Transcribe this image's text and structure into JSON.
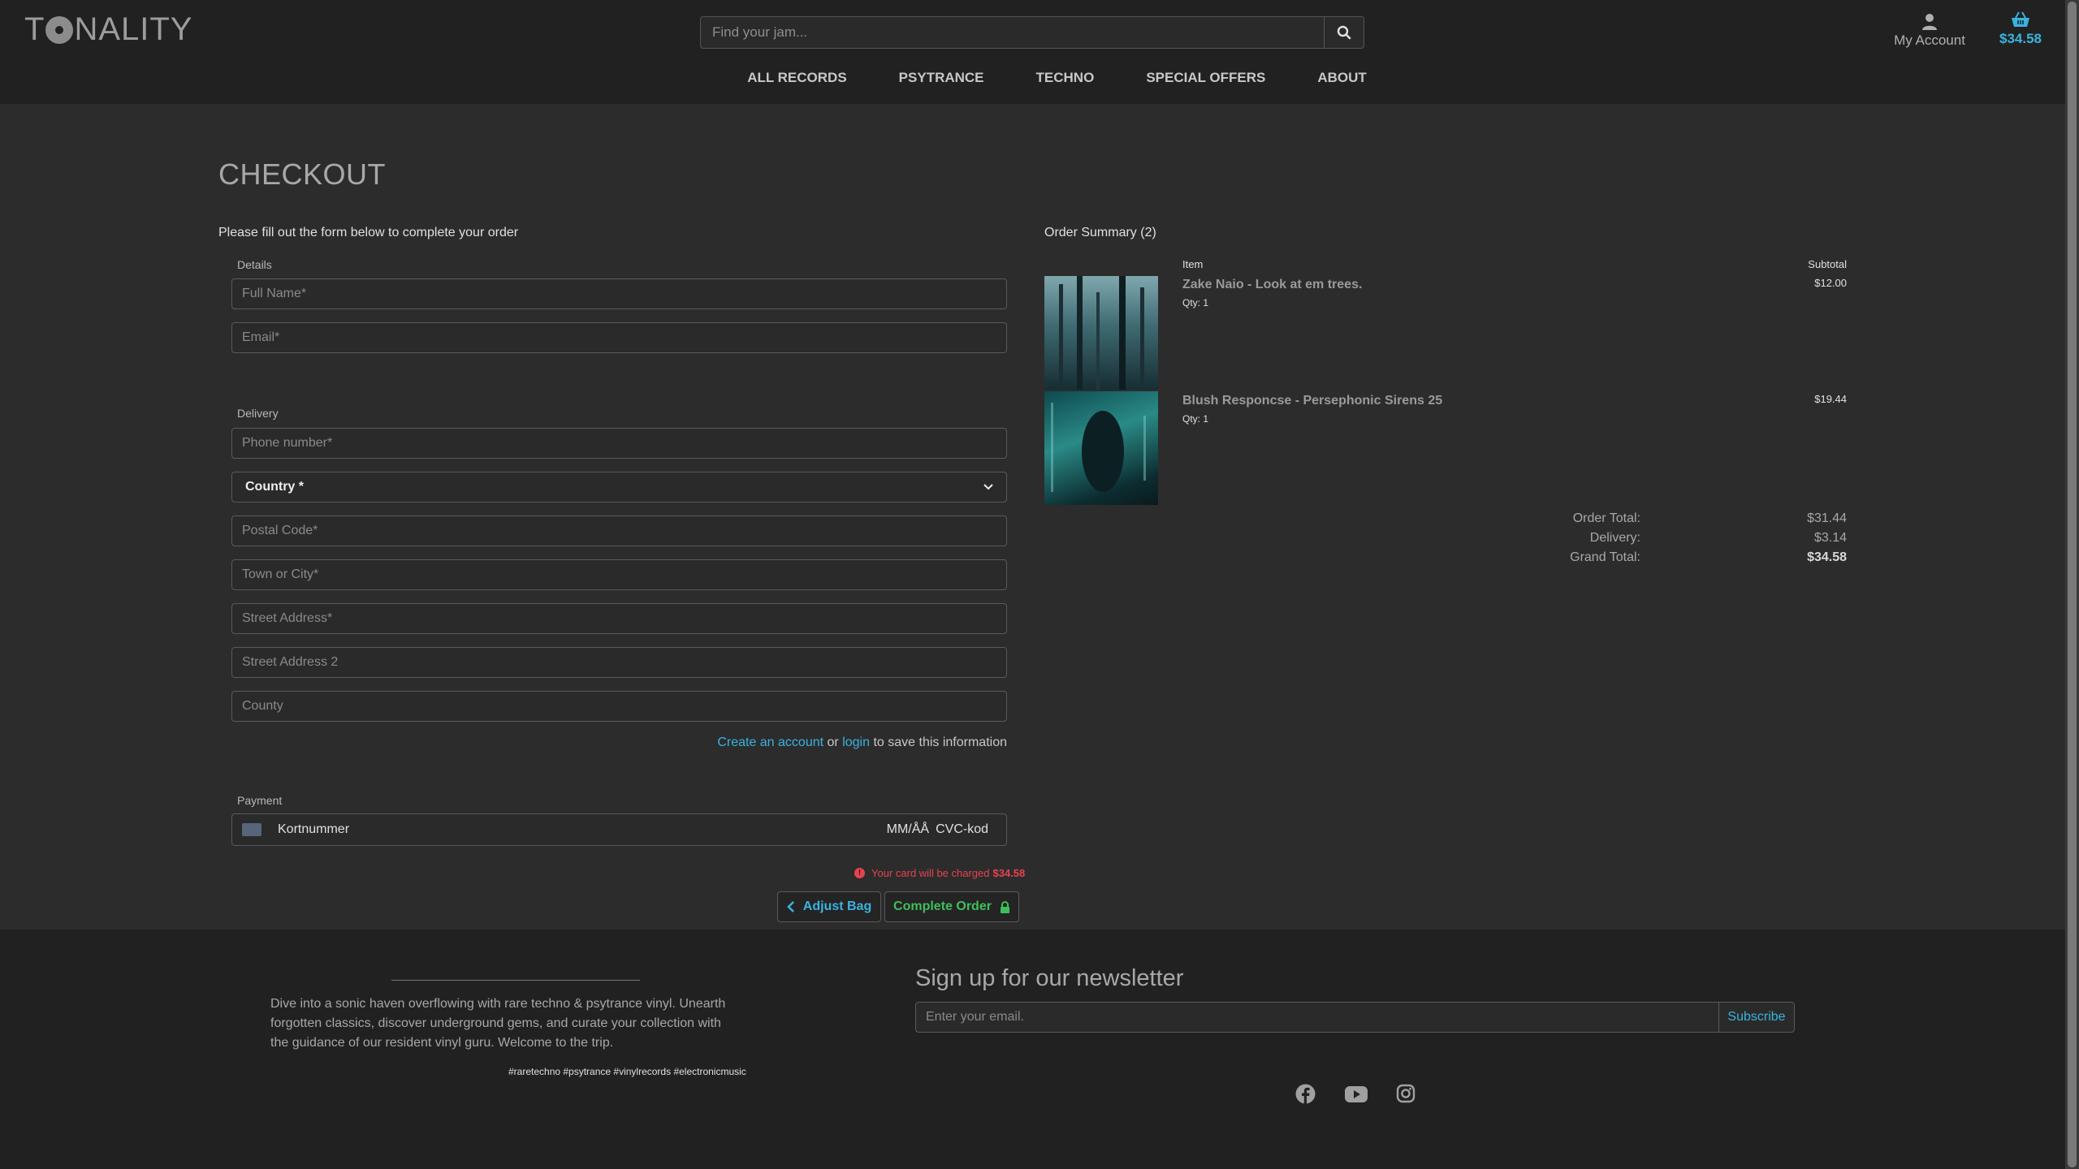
{
  "header": {
    "logo_text_pre": "T",
    "logo_text_post": "NALITY",
    "search_placeholder": "Find your jam...",
    "account_label": "My Account",
    "bag_total": "$34.58",
    "nav": [
      "ALL RECORDS",
      "PSYTRANCE",
      "TECHNO",
      "SPECIAL OFFERS",
      "ABOUT"
    ]
  },
  "checkout": {
    "title": "CHECKOUT",
    "intro": "Please fill out the form below to complete your order",
    "details_label": "Details",
    "full_name_placeholder": "Full Name*",
    "email_placeholder": "Email*",
    "delivery_label": "Delivery",
    "phone_placeholder": "Phone number*",
    "country_value": "Country *",
    "postal_placeholder": "Postal Code*",
    "town_placeholder": "Town or City*",
    "street1_placeholder": "Street Address*",
    "street2_placeholder": "Street Address 2",
    "county_placeholder": "County",
    "create_account": "Create an account",
    "or_text": "or",
    "login": "login",
    "save_text": "to save this information",
    "payment_label": "Payment",
    "card_number": "Kortnummer",
    "card_expiry": "MM/ÅÅ",
    "card_cvc": "CVC-kod",
    "charge_text": "Your card will be charged",
    "charge_amount": "$34.58",
    "adjust_bag": "Adjust Bag",
    "complete_order": "Complete Order"
  },
  "summary": {
    "title": "Order Summary (2)",
    "col_item": "Item",
    "col_subtotal": "Subtotal",
    "items": [
      {
        "name": "Zake Naio - Look at em trees.",
        "qty": "Qty: 1",
        "price": "$12.00"
      },
      {
        "name": "Blush Responcse - Persephonic Sirens 25",
        "qty": "Qty: 1",
        "price": "$19.44"
      }
    ],
    "order_total_label": "Order Total:",
    "order_total": "$31.44",
    "delivery_label": "Delivery:",
    "delivery": "$3.14",
    "grand_total_label": "Grand Total:",
    "grand_total": "$34.58"
  },
  "footer": {
    "about": "Dive into a sonic haven overflowing with rare techno & psytrance vinyl. Unearth forgotten classics, discover underground gems, and curate your collection with the guidance of our resident vinyl guru. Welcome to the trip.",
    "tags": "#raretechno #psytrance #vinylrecords #electronicmusic",
    "newsletter_title": "Sign up for our newsletter",
    "newsletter_placeholder": "Enter your email.",
    "subscribe": "Subscribe"
  },
  "colors": {
    "accent": "#3ab3e0",
    "success": "#3fbf5b",
    "danger": "#e5434f"
  },
  "icons": [
    "search-icon",
    "user-icon",
    "basket-icon",
    "chevron-left-icon",
    "lock-icon",
    "alert-icon",
    "facebook-icon",
    "youtube-icon",
    "instagram-icon"
  ]
}
